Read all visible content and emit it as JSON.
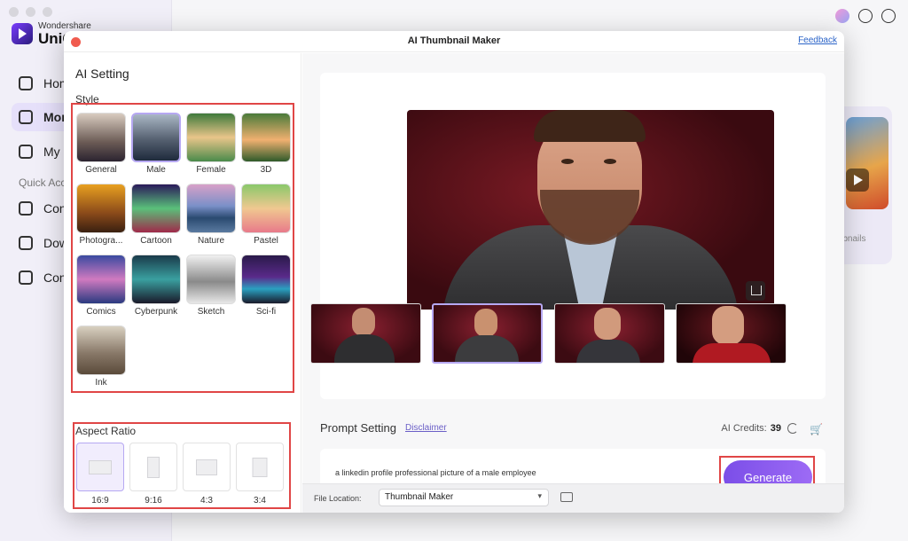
{
  "background_app": {
    "brand_sub": "Wondershare",
    "brand_name": "UniC",
    "nav": [
      {
        "label": "Hom"
      },
      {
        "label": "Mor"
      },
      {
        "label": "My I"
      },
      {
        "label": "Con"
      },
      {
        "label": "Dow"
      },
      {
        "label": "Con"
      }
    ],
    "section": "Quick Acc",
    "card_text": "mbnails"
  },
  "modal": {
    "title": "AI Thumbnail Maker",
    "feedback": "Feedback"
  },
  "ai_setting": {
    "title": "AI Setting",
    "style_label": "Style",
    "styles": [
      {
        "label": "General"
      },
      {
        "label": "Male",
        "selected": true
      },
      {
        "label": "Female"
      },
      {
        "label": "3D"
      },
      {
        "label": "Photogra..."
      },
      {
        "label": "Cartoon"
      },
      {
        "label": "Nature"
      },
      {
        "label": "Pastel"
      },
      {
        "label": "Comics"
      },
      {
        "label": "Cyberpunk"
      },
      {
        "label": "Sketch"
      },
      {
        "label": "Sci-fi"
      },
      {
        "label": "Ink"
      }
    ],
    "aspect_label": "Aspect Ratio",
    "aspects": [
      {
        "label": "16:9",
        "selected": true
      },
      {
        "label": "9:16"
      },
      {
        "label": "4:3"
      },
      {
        "label": "3:4"
      }
    ]
  },
  "prompt": {
    "label": "Prompt Setting",
    "disclaimer": "Disclaimer",
    "credits_label": "AI Credits:",
    "credits_value": "39",
    "text": "a linkedin profile professional picture of a male employee",
    "generate": "Generate"
  },
  "footer": {
    "file_location_label": "File Location:",
    "file_location_value": "Thumbnail Maker"
  },
  "colors": {
    "accent": "#8a5cf0",
    "highlight_box": "#e04646"
  }
}
